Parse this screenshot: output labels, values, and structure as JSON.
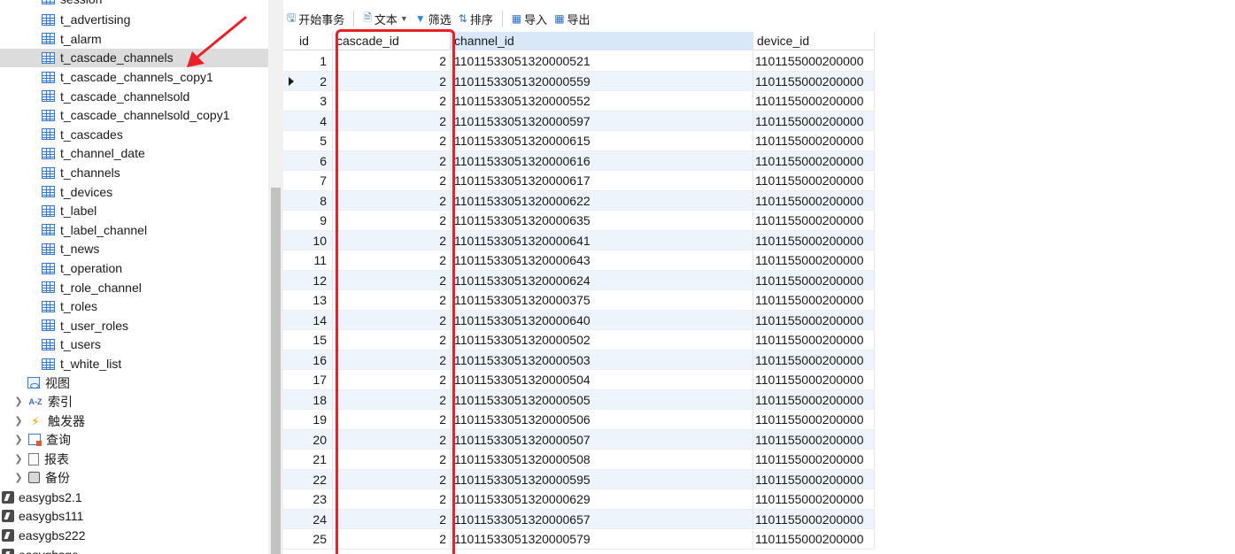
{
  "tree": {
    "partial_top_label": "session",
    "tables": [
      "t_advertising",
      "t_alarm",
      "t_cascade_channels",
      "t_cascade_channels_copy1",
      "t_cascade_channelsold",
      "t_cascade_channelsold_copy1",
      "t_cascades",
      "t_channel_date",
      "t_channels",
      "t_devices",
      "t_label",
      "t_label_channel",
      "t_news",
      "t_operation",
      "t_role_channel",
      "t_roles",
      "t_user_roles",
      "t_users",
      "t_white_list"
    ],
    "selected_table": "t_cascade_channels",
    "categories": {
      "views": "视图",
      "indexes": "索引",
      "triggers": "触发器",
      "queries": "查询",
      "reports": "报表",
      "backups": "备份"
    },
    "databases": [
      "easygbs2.1",
      "easygbs111",
      "easygbs222",
      "easygbsgo"
    ]
  },
  "toolbar": {
    "begin_transaction": "开始事务",
    "text": "文本",
    "filter": "筛选",
    "sort": "排序",
    "import": "导入",
    "export": "导出"
  },
  "grid": {
    "columns": {
      "id": "id",
      "cascade_id": "cascade_id",
      "channel_id": "channel_id",
      "device_id": "device_id"
    },
    "current_row": 2,
    "rows": [
      {
        "id": "1",
        "cascade_id": "2",
        "channel_id": "11011533051320000521",
        "device_id": "1101155000200000"
      },
      {
        "id": "2",
        "cascade_id": "2",
        "channel_id": "11011533051320000559",
        "device_id": "1101155000200000"
      },
      {
        "id": "3",
        "cascade_id": "2",
        "channel_id": "11011533051320000552",
        "device_id": "1101155000200000"
      },
      {
        "id": "4",
        "cascade_id": "2",
        "channel_id": "11011533051320000597",
        "device_id": "1101155000200000"
      },
      {
        "id": "5",
        "cascade_id": "2",
        "channel_id": "11011533051320000615",
        "device_id": "1101155000200000"
      },
      {
        "id": "6",
        "cascade_id": "2",
        "channel_id": "11011533051320000616",
        "device_id": "1101155000200000"
      },
      {
        "id": "7",
        "cascade_id": "2",
        "channel_id": "11011533051320000617",
        "device_id": "1101155000200000"
      },
      {
        "id": "8",
        "cascade_id": "2",
        "channel_id": "11011533051320000622",
        "device_id": "1101155000200000"
      },
      {
        "id": "9",
        "cascade_id": "2",
        "channel_id": "11011533051320000635",
        "device_id": "1101155000200000"
      },
      {
        "id": "10",
        "cascade_id": "2",
        "channel_id": "11011533051320000641",
        "device_id": "1101155000200000"
      },
      {
        "id": "11",
        "cascade_id": "2",
        "channel_id": "11011533051320000643",
        "device_id": "1101155000200000"
      },
      {
        "id": "12",
        "cascade_id": "2",
        "channel_id": "11011533051320000624",
        "device_id": "1101155000200000"
      },
      {
        "id": "13",
        "cascade_id": "2",
        "channel_id": "11011533051320000375",
        "device_id": "1101155000200000"
      },
      {
        "id": "14",
        "cascade_id": "2",
        "channel_id": "11011533051320000640",
        "device_id": "1101155000200000"
      },
      {
        "id": "15",
        "cascade_id": "2",
        "channel_id": "11011533051320000502",
        "device_id": "1101155000200000"
      },
      {
        "id": "16",
        "cascade_id": "2",
        "channel_id": "11011533051320000503",
        "device_id": "1101155000200000"
      },
      {
        "id": "17",
        "cascade_id": "2",
        "channel_id": "11011533051320000504",
        "device_id": "1101155000200000"
      },
      {
        "id": "18",
        "cascade_id": "2",
        "channel_id": "11011533051320000505",
        "device_id": "1101155000200000"
      },
      {
        "id": "19",
        "cascade_id": "2",
        "channel_id": "11011533051320000506",
        "device_id": "1101155000200000"
      },
      {
        "id": "20",
        "cascade_id": "2",
        "channel_id": "11011533051320000507",
        "device_id": "1101155000200000"
      },
      {
        "id": "21",
        "cascade_id": "2",
        "channel_id": "11011533051320000508",
        "device_id": "1101155000200000"
      },
      {
        "id": "22",
        "cascade_id": "2",
        "channel_id": "11011533051320000595",
        "device_id": "1101155000200000"
      },
      {
        "id": "23",
        "cascade_id": "2",
        "channel_id": "11011533051320000629",
        "device_id": "1101155000200000"
      },
      {
        "id": "24",
        "cascade_id": "2",
        "channel_id": "11011533051320000657",
        "device_id": "1101155000200000"
      },
      {
        "id": "25",
        "cascade_id": "2",
        "channel_id": "11011533051320000579",
        "device_id": "1101155000200000"
      }
    ]
  },
  "annotation_color": "#e8202a"
}
